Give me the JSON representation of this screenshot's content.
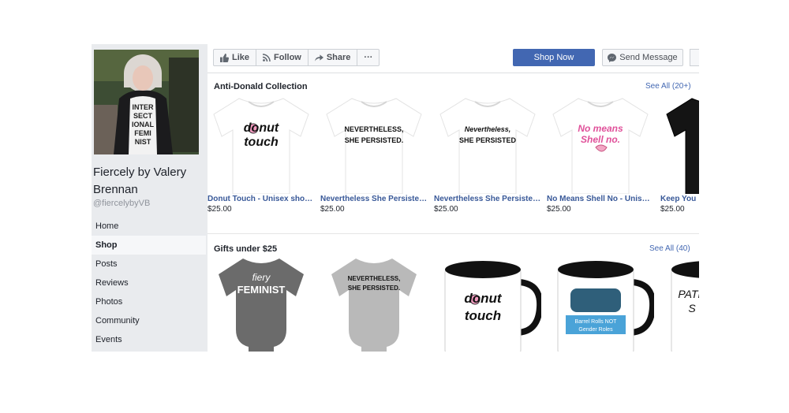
{
  "sidebar": {
    "page_name": "Fiercely by Valery Brennan",
    "handle": "@fiercelybyVB",
    "photo_shirt_text": [
      "INTER",
      "SECT",
      "IONAL",
      "FEMI",
      "NIST"
    ],
    "nav": [
      {
        "label": "Home",
        "active": false
      },
      {
        "label": "Shop",
        "active": true
      },
      {
        "label": "Posts",
        "active": false
      },
      {
        "label": "Reviews",
        "active": false
      },
      {
        "label": "Photos",
        "active": false
      },
      {
        "label": "Community",
        "active": false
      },
      {
        "label": "Events",
        "active": false
      }
    ]
  },
  "actions": {
    "like": "Like",
    "follow": "Follow",
    "share": "Share",
    "more": "···",
    "shop_now": "Shop Now",
    "send_message": "Send Message"
  },
  "sections": [
    {
      "title": "Anti-Donald Collection",
      "see_all": "See All (20+)",
      "products": [
        {
          "name": "Donut Touch - Unisex short sl...",
          "price": "$25.00",
          "print": [
            "donut",
            "touch"
          ]
        },
        {
          "name": "Nevertheless She Persisted (...",
          "price": "$25.00",
          "print": [
            "NEVERTHELESS,",
            "SHE PERSISTED."
          ]
        },
        {
          "name": "Nevertheless She Persisted -...",
          "price": "$25.00",
          "print": [
            "Nevertheless,",
            "SHE PERSISTED"
          ]
        },
        {
          "name": "No Means Shell No - Unisex s...",
          "price": "$25.00",
          "print": [
            "No means",
            "Shell no."
          ]
        },
        {
          "name": "Keep You",
          "price": "$25.00",
          "print": []
        }
      ]
    },
    {
      "title": "Gifts under $25",
      "see_all": "See All (40)",
      "products": [
        {
          "print": [
            "fiery",
            "FEMINIST"
          ]
        },
        {
          "print": [
            "NEVERTHELESS,",
            "SHE PERSISTED."
          ]
        },
        {
          "print": [
            "donut",
            "touch"
          ]
        },
        {
          "print": [
            "Barrel Rolls NOT",
            "Gender Roles"
          ]
        },
        {
          "print": [
            "PATR",
            "S"
          ]
        }
      ]
    }
  ],
  "colors": {
    "brand_blue": "#4267b2",
    "link_blue": "#385898",
    "sidebar_bg": "#e9ebee"
  }
}
